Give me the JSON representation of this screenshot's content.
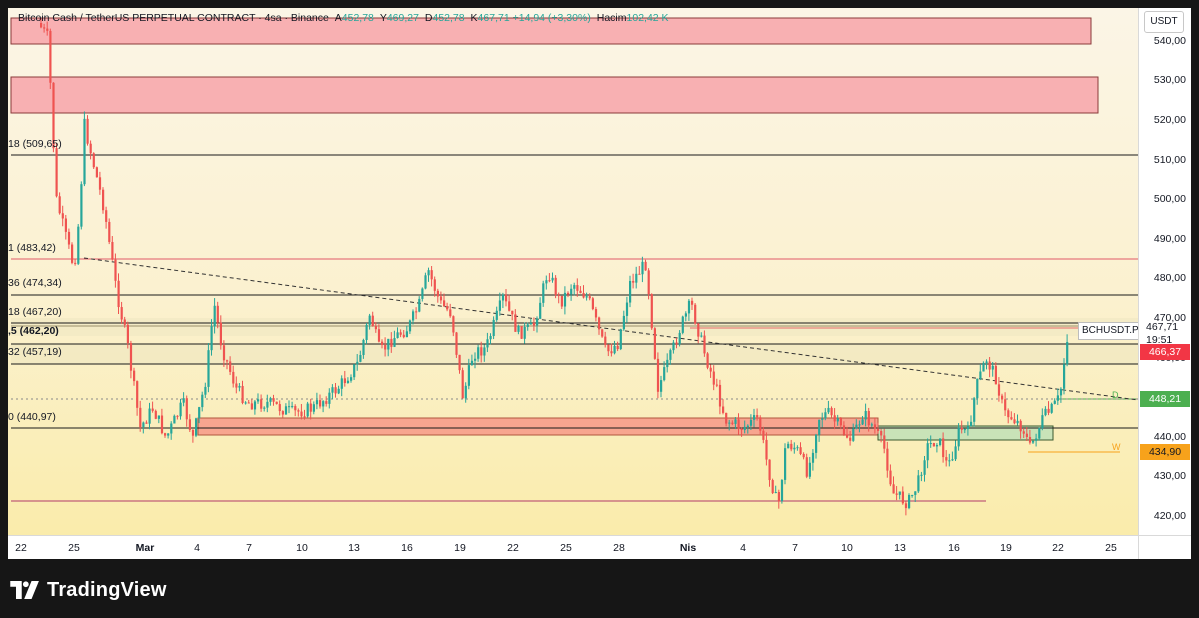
{
  "legend": {
    "symbol": "Bitcoin Cash / TetherUS PERPETUAL CONTRACT · 4sa · Binance",
    "open_label": "A",
    "open": "452,78",
    "high_label": "Y",
    "high": "469,27",
    "low_label": "D",
    "low": "452,78",
    "close_label": "K",
    "close": "467,71",
    "change": "+14,94 (+3,30%)",
    "volume_label": "Hacim",
    "volume": "102,42 K"
  },
  "price_axis": {
    "currency": "USDT",
    "ticks": [
      "540,00",
      "530,00",
      "520,00",
      "510,00",
      "500,00",
      "490,00",
      "480,00",
      "470,00",
      "460,00",
      "450,00",
      "440,00",
      "430,00",
      "420,00"
    ]
  },
  "time_axis": {
    "ticks": [
      "22",
      "25",
      "Mar",
      "4",
      "7",
      "10",
      "13",
      "16",
      "19",
      "22",
      "25",
      "28",
      "Nis",
      "4",
      "7",
      "10",
      "13",
      "16",
      "19",
      "22",
      "25"
    ]
  },
  "level_labels": [
    "18 (509,65)",
    "1 (483,42)",
    "36 (474,34)",
    "18 (467,20)",
    ",5 (462,20)",
    "32 (457,19)",
    "0 (440,97)"
  ],
  "price_badges": {
    "symbol_tag": "BCHUSDT.P",
    "last_price": "467,71",
    "countdown": "19:51",
    "level_red": "466,37",
    "level_green": "448,21",
    "level_orange": "434,90"
  },
  "markers": {
    "green_marker": "D",
    "orange_marker": "W"
  },
  "colors": {
    "bullish": "#26a69a",
    "bearish": "#ef5350",
    "zone_red": "#f8b0b2",
    "zone_orange": "#f7a58f",
    "zone_green": "#c9e3b8",
    "badge_red": "#f23645",
    "badge_green": "#4caf50",
    "badge_orange": "#f7a21b"
  },
  "footer": {
    "brand": "TradingView",
    "logo_icon": "tradingview-logo-icon"
  }
}
